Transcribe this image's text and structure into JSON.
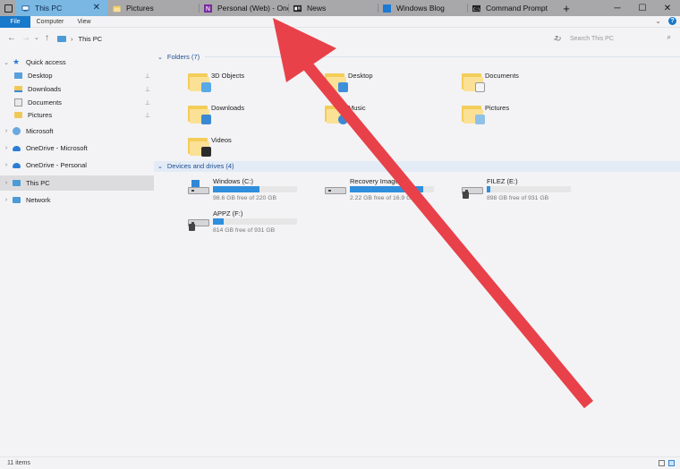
{
  "tabs": [
    {
      "label": "This PC",
      "icon": "this-pc-icon",
      "active": true,
      "close": "✕"
    },
    {
      "label": "Pictures",
      "icon": "folder-icon"
    },
    {
      "label": "Personal (Web) - One",
      "icon": "onenote-icon"
    },
    {
      "label": "News",
      "icon": "news-icon"
    },
    {
      "label": "Windows Blog",
      "icon": "windows-icon"
    },
    {
      "label": "Command Prompt",
      "icon": "command-prompt-icon"
    }
  ],
  "new_tab": "+",
  "window_controls": {
    "minimize": "─",
    "maximize": "☐",
    "close": "✕"
  },
  "ribbon": {
    "file": "File",
    "computer": "Computer",
    "view": "View",
    "help": "?",
    "expand": "⌄"
  },
  "address": {
    "location": "This PC",
    "back": "←",
    "forward": "→",
    "up": "↑",
    "recent": "⌄",
    "separator": "›",
    "dropdown": "⌄",
    "refresh": "↻"
  },
  "search": {
    "placeholder": "Search This PC",
    "icon": "⌕"
  },
  "sidebar": {
    "quick_access": "Quick access",
    "items": [
      {
        "label": "Desktop"
      },
      {
        "label": "Downloads"
      },
      {
        "label": "Documents"
      },
      {
        "label": "Pictures"
      }
    ],
    "microsoft": "Microsoft",
    "onedrive_microsoft": "OneDrive - Microsoft",
    "onedrive_personal": "OneDrive - Personal",
    "this_pc": "This PC",
    "network": "Network",
    "pin": "📌",
    "chev_open": "⌄",
    "chev_closed": "›"
  },
  "folders": {
    "heading": "Folders (7)",
    "items": [
      "3D Objects",
      "Desktop",
      "Documents",
      "Downloads",
      "Music",
      "Pictures",
      "Videos"
    ]
  },
  "devices": {
    "heading": "Devices and drives (4)",
    "items": [
      {
        "name": "Windows (C:)",
        "free": "98.6 GB free of 220 GB",
        "used_fraction": 0.55
      },
      {
        "name": "Recovery Image (",
        "free": "2.22 GB free of 16.9 G",
        "used_fraction": 0.87
      },
      {
        "name": "FILEZ (E:)",
        "free": "898 GB free of 931 GB",
        "used_fraction": 0.04
      },
      {
        "name": "APPZ (F:)",
        "free": "814 GB free of 931 GB",
        "used_fraction": 0.13
      }
    ]
  },
  "status": {
    "items": "11 items"
  },
  "colors": {
    "accent": "#1979ca",
    "arrow": "#e8414a",
    "tab_active": "#7ab7e3"
  }
}
